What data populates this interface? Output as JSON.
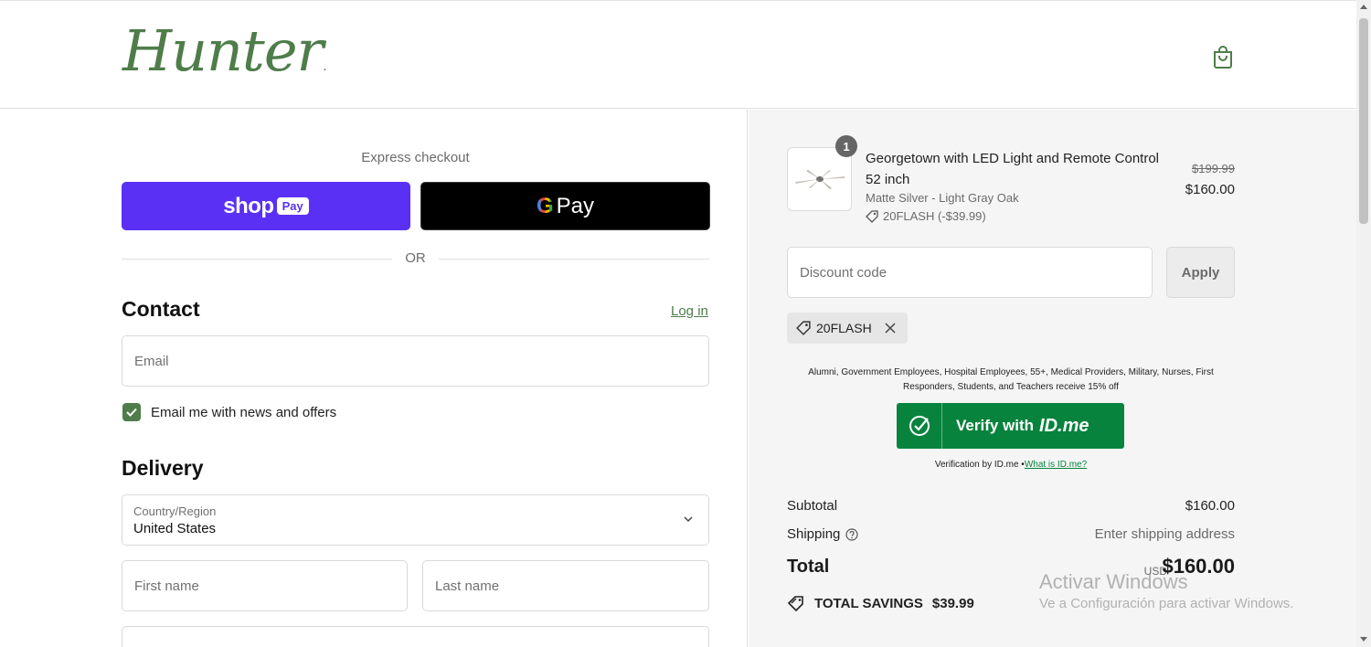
{
  "header": {
    "logo_text": "Hunter",
    "cart_icon": "shopping-bag-icon"
  },
  "express": {
    "title": "Express checkout",
    "shop_word": "shop",
    "shop_pay": "Pay",
    "gpay_g": "G",
    "gpay_word": "Pay",
    "or": "OR"
  },
  "contact": {
    "title": "Contact",
    "login": "Log in",
    "email_placeholder": "Email",
    "news_checkbox_label": "Email me with news and offers",
    "news_checked": true
  },
  "delivery": {
    "title": "Delivery",
    "country_label": "Country/Region",
    "country_value": "United States",
    "first_name_placeholder": "First name",
    "last_name_placeholder": "Last name"
  },
  "order": {
    "quantity": "1",
    "product_name": "Georgetown with LED Light and Remote Control 52 inch",
    "variant": "Matte Silver - Light Gray Oak",
    "discount_line": "20FLASH (-$39.99)",
    "price_old": "$199.99",
    "price_new": "$160.00",
    "discount_placeholder": "Discount code",
    "apply_label": "Apply",
    "applied_code": "20FLASH",
    "idme_text": "Alumni, Government Employees, Hospital Employees, 55+, Medical Providers, Military, Nurses, First Responders, Students, and Teachers receive 15% off",
    "idme_button_label": "Verify with",
    "idme_brand": "ID.me",
    "idme_note": "Verification by ID.me •",
    "idme_link": "What is ID.me?",
    "subtotal_label": "Subtotal",
    "subtotal_value": "$160.00",
    "shipping_label": "Shipping",
    "shipping_value": "Enter shipping address",
    "total_label": "Total",
    "total_currency": "USD",
    "total_value": "$160.00",
    "savings_label": "TOTAL SAVINGS",
    "savings_value": "$39.99"
  },
  "watermark": {
    "line1": "Activar Windows",
    "line2": "Ve a Configuración para activar Windows."
  },
  "colors": {
    "brand_green": "#4e7d4a",
    "shop_pay_purple": "#5a31f4",
    "idme_green": "#08833d"
  }
}
